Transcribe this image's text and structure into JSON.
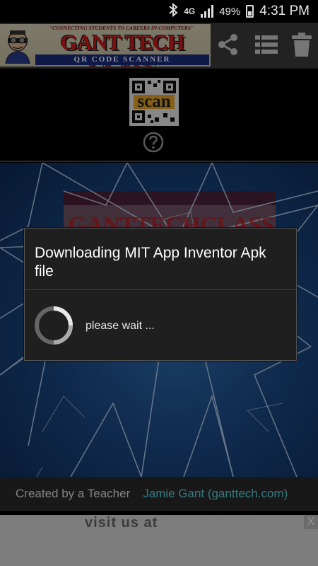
{
  "status_bar": {
    "network": "4G",
    "battery": "49%",
    "time": "4:31 PM"
  },
  "app_bar": {
    "banner_tagline": "\"CONNECTING STUDENTS TO CAREERS IN COMPUTERS\"",
    "banner_title": "GANT TECH CLASS",
    "banner_subtitle": "QR CODE SCANNER",
    "actions": [
      "share-icon",
      "list-icon",
      "delete-icon"
    ]
  },
  "scanner": {
    "scan_label": "scan",
    "help_icon": "question-circle-icon"
  },
  "hero": {
    "background_text": "GANTTECHCLASS"
  },
  "dialog": {
    "title": "Downloading MIT App Inventor Apk file",
    "message": "please wait ..."
  },
  "footer": {
    "created_label": "Created by a Teacher",
    "author_link": "Jamie Gant (ganttech.com)"
  },
  "ad": {
    "text": "visit us at",
    "close": "X"
  },
  "colors": {
    "link": "#5ad0e0",
    "banner_red": "#d61a1a",
    "banner_blue": "#1a2b7a"
  }
}
